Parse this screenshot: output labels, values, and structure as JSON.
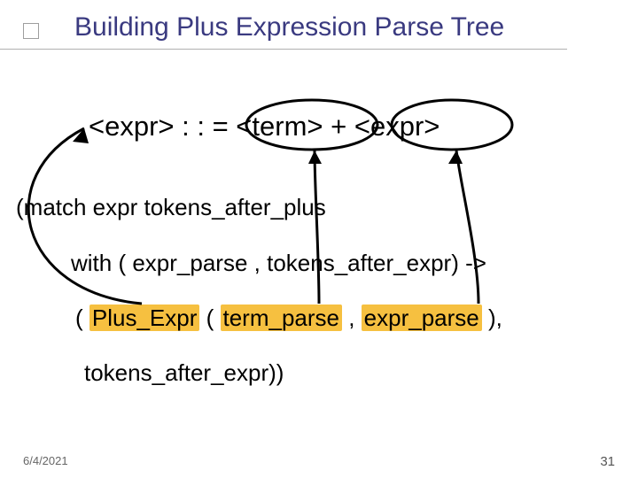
{
  "title": "Building Plus Expression Parse Tree",
  "grammar": {
    "lhs": "<expr>",
    "op": " : : = ",
    "term": "<term>",
    "plus": " + ",
    "rhs": "<expr>"
  },
  "code": {
    "l1": "(match expr tokens_after_plus",
    "l2_a": "with ( expr_parse  , tokens_after_expr) ->",
    "l3_open": "( ",
    "l3_plus": "Plus_Expr",
    "l3_sep1": "  ( ",
    "l3_term": "term_parse",
    "l3_sep2": "  ,  ",
    "l3_expr": "expr_parse",
    "l3_close": " ),",
    "l4": "tokens_after_expr))"
  },
  "footer": {
    "date": "6/4/2021",
    "page": "31"
  }
}
